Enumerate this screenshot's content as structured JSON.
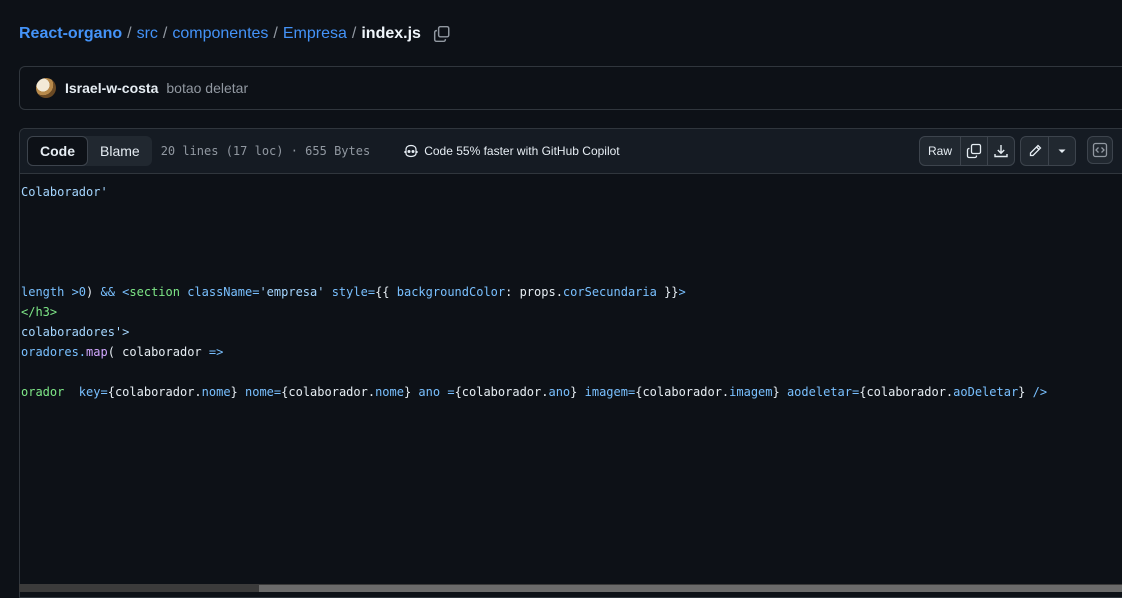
{
  "breadcrumb": {
    "repo": "React-organo",
    "dir1": "src",
    "dir2": "componentes",
    "dir3": "Empresa",
    "file": "index.js",
    "separator": "/"
  },
  "commit": {
    "author": "Israel-w-costa",
    "message": "botao deletar"
  },
  "file_header": {
    "tab_code": "Code",
    "tab_blame": "Blame",
    "info": "20 lines (17 loc) · 655 Bytes",
    "copilot": "Code 55% faster with GitHub Copilot",
    "raw": "Raw"
  },
  "icons": {
    "copy_path": "copy-icon",
    "copilot": "copilot-icon",
    "copy_raw": "copy-icon",
    "download": "download-icon",
    "edit": "pencil-icon",
    "dropdown": "triangle-down-icon",
    "symbols": "code-square-icon"
  },
  "code": {
    "line1": "Colaborador'",
    "line2a": "length >",
    "line2b": "0",
    "line2c": ") ",
    "line2d": "&& <",
    "line2e": "section ",
    "line2f": "className",
    "line2g": "=",
    "line2h": "'empresa' ",
    "line2i": "style",
    "line2j": "=",
    "line2k": "{{ ",
    "line2l": "backgroundColor",
    "line2m": ": props.",
    "line2n": "corSecundaria",
    "line2o": " }}",
    "line2p": ">",
    "line3": "</h3>",
    "line4": "colaboradores'>",
    "line5a": "oradores.",
    "line5b": "map",
    "line5c": "( colaborador ",
    "line5d": "=>",
    "line6a": "orador  ",
    "line6b": "key",
    "line6c": "=",
    "line6d": "{colaborador.",
    "line6e": "nome",
    "line6f": "} ",
    "line6g": "nome",
    "line6h": "=",
    "line6i": "{colaborador.",
    "line6j": "nome",
    "line6k": "} ",
    "line6l": "ano ",
    "line6m": "=",
    "line6n": "{colaborador.",
    "line6o": "ano",
    "line6p": "} ",
    "line6q": "imagem",
    "line6r": "=",
    "line6s": "{colaborador.",
    "line6t": "imagem",
    "line6u": "} ",
    "line6v": "aodeletar",
    "line6w": "=",
    "line6x": "{colaborador.",
    "line6y": "aoDeletar",
    "line6z": "} ",
    "line6end": "/>"
  }
}
